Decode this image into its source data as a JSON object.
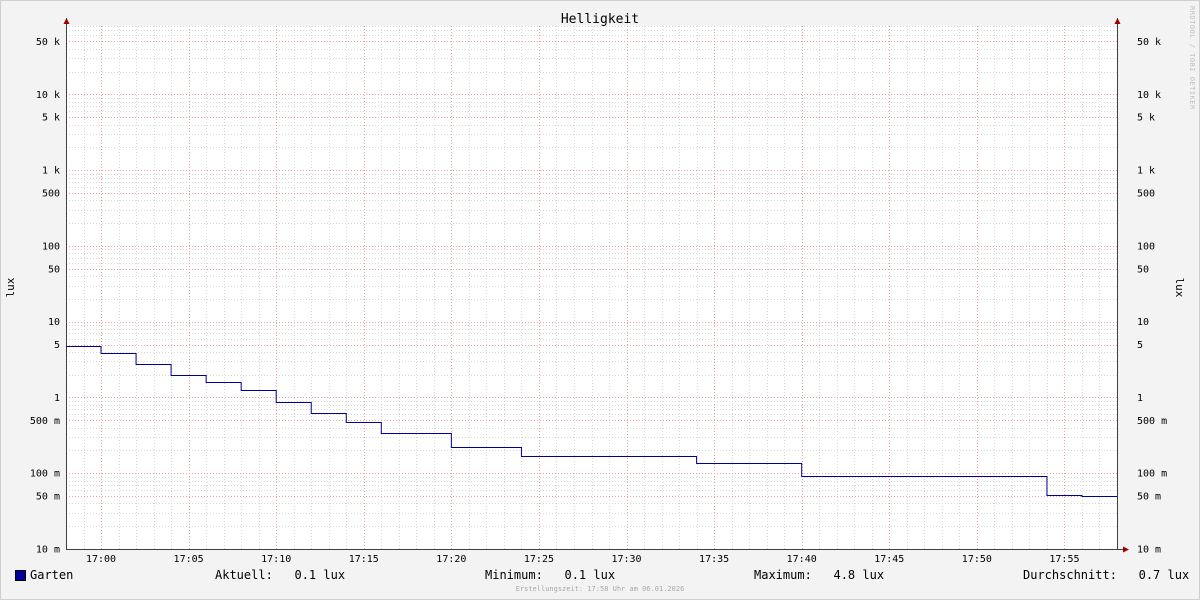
{
  "chart_data": {
    "type": "line",
    "title": "Helligkeit",
    "ylabel": "lux",
    "ylabel_right": "lux",
    "yscale": "log",
    "ylim": [
      0.01,
      80000
    ],
    "ytick_values": [
      0.01,
      0.05,
      0.1,
      0.5,
      1,
      5,
      10,
      50,
      100,
      500,
      1000,
      5000,
      10000,
      50000
    ],
    "ytick_labels": [
      "10 m",
      "50 m",
      "100 m",
      "500 m",
      "1",
      "5",
      "10",
      "50",
      "100",
      "500",
      "1 k",
      "5 k",
      "10 k",
      "50 k"
    ],
    "x_unit": "minutes",
    "xlim": [
      "16:58",
      "17:58"
    ],
    "xtick_labels": [
      "17:00",
      "17:05",
      "17:10",
      "17:15",
      "17:20",
      "17:25",
      "17:30",
      "17:35",
      "17:40",
      "17:45",
      "17:50",
      "17:55"
    ],
    "series": [
      {
        "name": "Garten",
        "color": "#000099",
        "step": true,
        "points": [
          [
            "16:58",
            4.8
          ],
          [
            "17:00",
            3.9
          ],
          [
            "17:02",
            2.8
          ],
          [
            "17:04",
            2.0
          ],
          [
            "17:06",
            1.6
          ],
          [
            "17:08",
            1.25
          ],
          [
            "17:10",
            0.88
          ],
          [
            "17:12",
            0.62
          ],
          [
            "17:14",
            0.48
          ],
          [
            "17:16",
            0.34
          ],
          [
            "17:20",
            0.22
          ],
          [
            "17:24",
            0.17
          ],
          [
            "17:34",
            0.135
          ],
          [
            "17:40",
            0.093
          ],
          [
            "17:54",
            0.052
          ],
          [
            "17:56",
            0.05
          ],
          [
            "17:58",
            0.05
          ]
        ]
      }
    ],
    "grid": true,
    "legend_position": "bottom"
  },
  "legend": {
    "series_name": "Garten",
    "aktuell_label": "Aktuell:",
    "aktuell_value": "0.1 lux",
    "minimum_label": "Minimum:",
    "minimum_value": "0.1 lux",
    "maximum_label": "Maximum:",
    "maximum_value": "4.8 lux",
    "durchschnitt_label": "Durchschnitt:",
    "durchschnitt_value": "0.7 lux"
  },
  "footer": {
    "creation_text": "Erstellungszeit: 17:58 Uhr am 06.01.2026",
    "watermark": "RRDTOOL / TOBI OETIKER"
  },
  "colors": {
    "series": "#000099",
    "major_grid": "#f0a0a0",
    "minor_grid": "#d8d8d8",
    "background": "#f3f3f3",
    "plot_bg": "#ffffff",
    "arrow": "#990000"
  }
}
